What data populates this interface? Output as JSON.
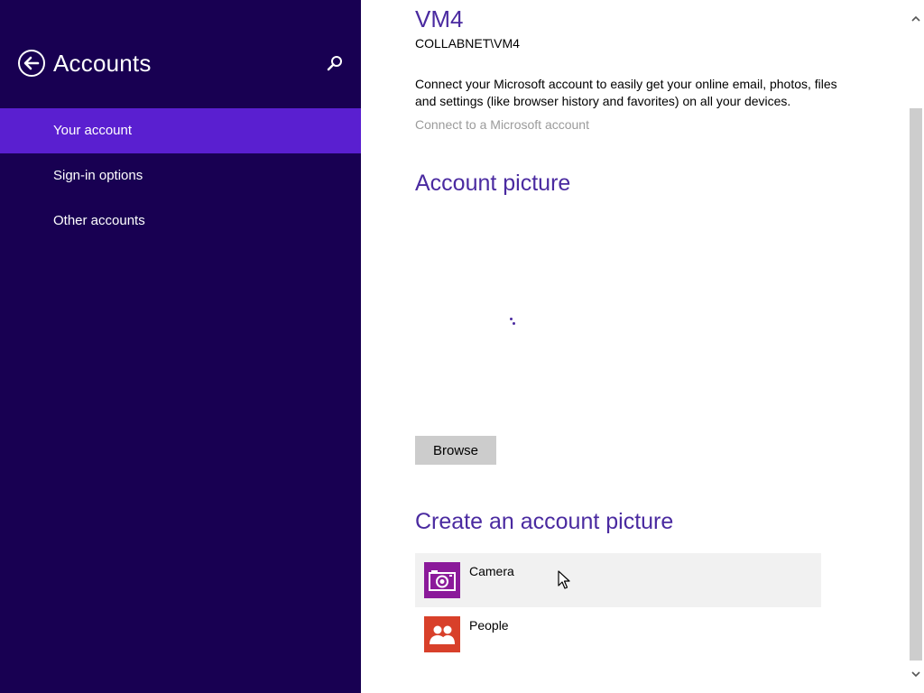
{
  "header": {
    "title": "Accounts",
    "back_icon": "back-arrow-icon",
    "search_icon": "search-icon"
  },
  "nav": {
    "items": [
      {
        "label": "Your account",
        "selected": true
      },
      {
        "label": "Sign-in options",
        "selected": false
      },
      {
        "label": "Other accounts",
        "selected": false
      }
    ]
  },
  "account": {
    "name": "VM4",
    "domain": "COLLABNET\\VM4",
    "connect_description": "Connect your Microsoft account to easily get your online email, photos, files and settings (like browser history and favorites) on all your devices.",
    "connect_link": "Connect to a Microsoft account"
  },
  "account_picture": {
    "title": "Account picture",
    "browse_label": "Browse"
  },
  "create_picture": {
    "title": "Create an account picture",
    "apps": [
      {
        "label": "Camera",
        "icon": "camera-icon",
        "color": "#8b1a9a"
      },
      {
        "label": "People",
        "icon": "people-icon",
        "color": "#d8402a"
      }
    ]
  },
  "colors": {
    "left_pane_bg": "#180052",
    "selected_item_bg": "#5a1fd0",
    "heading_accent": "#4a2aa0",
    "link_gray": "#9b9b9b"
  }
}
